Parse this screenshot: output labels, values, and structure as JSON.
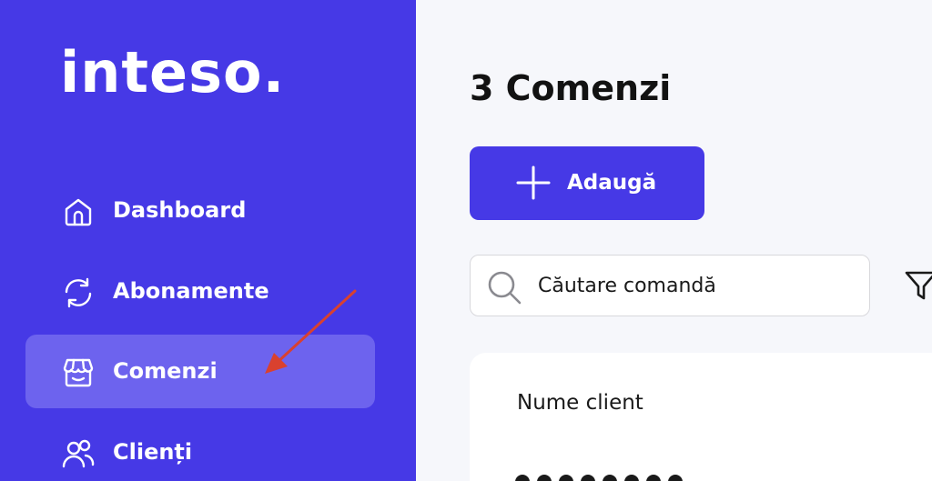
{
  "brand": {
    "logo_text": "inteso."
  },
  "sidebar": {
    "items": [
      {
        "label": "Dashboard",
        "icon": "home-icon",
        "active": false
      },
      {
        "label": "Abonamente",
        "icon": "refresh-icon",
        "active": false
      },
      {
        "label": "Comenzi",
        "icon": "store-icon",
        "active": true
      },
      {
        "label": "Clienți",
        "icon": "users-icon",
        "active": false
      }
    ]
  },
  "main": {
    "title": "3 Comenzi",
    "add_button_label": "Adaugă",
    "search": {
      "placeholder": "Căutare comandă",
      "value": ""
    },
    "table": {
      "columns": [
        "Nume client"
      ]
    }
  },
  "colors": {
    "brand": "#4639e6",
    "sidebar_active": "#6d63ee",
    "annotation_arrow": "#d9412f"
  }
}
